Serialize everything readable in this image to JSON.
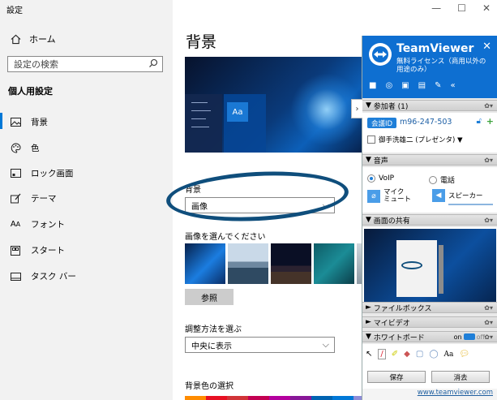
{
  "window": {
    "title": "設定"
  },
  "nav": {
    "home": "ホーム",
    "search_placeholder": "設定の検索",
    "section": "個人用設定",
    "items": [
      {
        "label": "背景",
        "icon": "image-icon"
      },
      {
        "label": "色",
        "icon": "palette-icon"
      },
      {
        "label": "ロック画面",
        "icon": "lock-screen-icon"
      },
      {
        "label": "テーマ",
        "icon": "theme-brush-icon"
      },
      {
        "label": "フォント",
        "icon": "font-icon"
      },
      {
        "label": "スタート",
        "icon": "start-icon"
      },
      {
        "label": "タスク バー",
        "icon": "taskbar-icon"
      }
    ]
  },
  "main": {
    "title": "背景",
    "preview_sample": "Aa",
    "background_label": "背景",
    "background_value": "画像",
    "choose_label": "画像を選んでください",
    "browse_button": "参照",
    "fit_label": "調整方法を選ぶ",
    "fit_value": "中央に表示",
    "color_label": "背景色の選択"
  },
  "teamviewer": {
    "name": "TeamViewer",
    "subtitle": "無料ライセンス（商用以外の用途のみ）",
    "participants_header": "参加者 (1)",
    "meeting_id_badge": "会議ID",
    "meeting_id": "m96-247-503",
    "presenter": "御手洗雄二 (プレゼンタ) ▼",
    "audio_header": "音声",
    "voip": "VoIP",
    "phone": "電話",
    "mic_label": "マイク",
    "mic_state": "ミュート",
    "speaker_label": "スピーカー",
    "screen_share_header": "画面の共有",
    "filebox_header": "ファイルボックス",
    "myvideo_header": "マイビデオ",
    "whiteboard_header": "ホワイトボード",
    "toggle_on": "on",
    "toggle_off": "off",
    "save_button": "保存",
    "clear_button": "消去",
    "footer_link": "www.teamviewer.com"
  }
}
